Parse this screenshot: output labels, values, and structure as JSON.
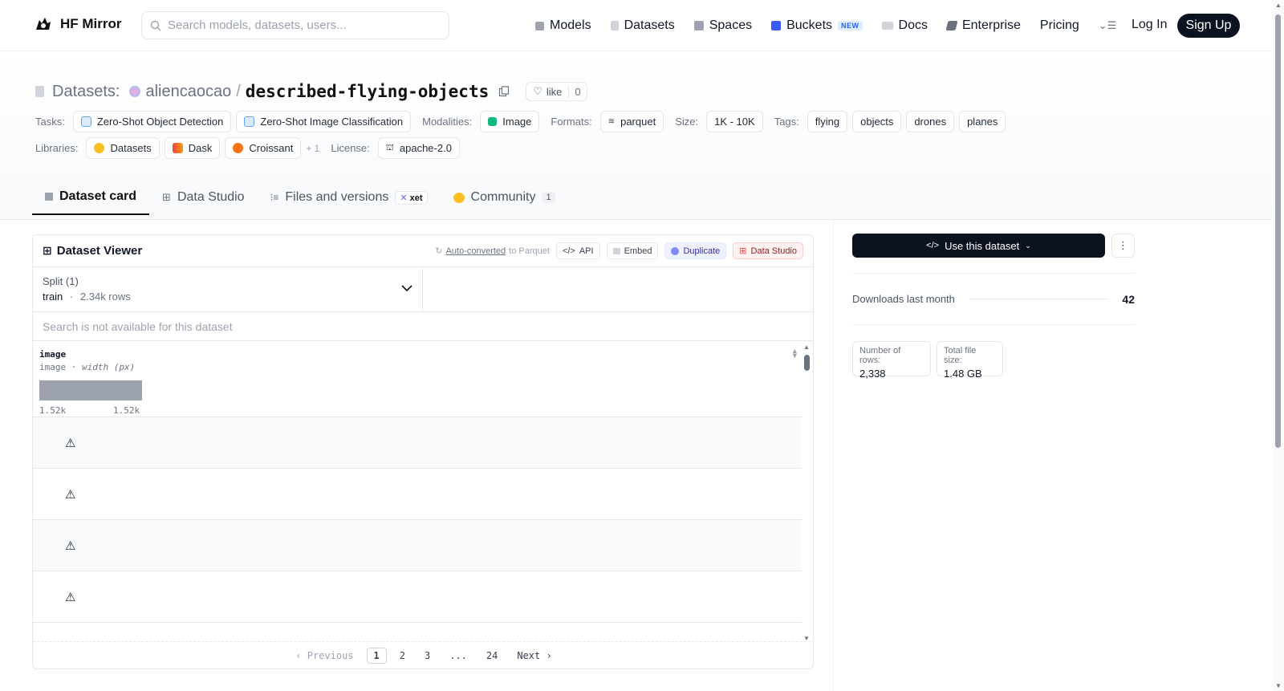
{
  "brand": {
    "name": "HF Mirror"
  },
  "search": {
    "placeholder": "Search models, datasets, users..."
  },
  "nav": {
    "items": [
      {
        "label": "Models",
        "icon": "cube-icon"
      },
      {
        "label": "Datasets",
        "icon": "database-icon"
      },
      {
        "label": "Spaces",
        "icon": "grid-icon"
      },
      {
        "label": "Buckets",
        "icon": "bucket-icon",
        "badge": "NEW"
      },
      {
        "label": "Docs",
        "icon": "book-icon"
      },
      {
        "label": "Enterprise",
        "icon": "enterprise-icon"
      },
      {
        "label": "Pricing"
      }
    ],
    "login": "Log In",
    "signup": "Sign Up"
  },
  "header": {
    "section": "Datasets:",
    "owner": "aliencaocao",
    "slash": "/",
    "name": "described-flying-objects",
    "like_label": "like",
    "like_count": "0"
  },
  "meta": {
    "tasks_label": "Tasks:",
    "tasks": [
      "Zero-Shot Object Detection",
      "Zero-Shot Image Classification"
    ],
    "modalities_label": "Modalities:",
    "modalities": [
      "Image"
    ],
    "formats_label": "Formats:",
    "formats": [
      "parquet"
    ],
    "size_label": "Size:",
    "size": "1K - 10K",
    "tags_label": "Tags:",
    "tags": [
      "flying",
      "objects",
      "drones",
      "planes"
    ],
    "libraries_label": "Libraries:",
    "libraries": [
      "Datasets",
      "Dask",
      "Croissant"
    ],
    "libraries_more": "+ 1",
    "license_label": "License:",
    "license": "apache-2.0"
  },
  "tabs": {
    "card": "Dataset card",
    "studio": "Data Studio",
    "files": "Files and versions",
    "xet": "xet",
    "community": "Community",
    "community_count": "1"
  },
  "viewer": {
    "title": "Dataset Viewer",
    "auto_converted": "Auto-converted",
    "to_parquet": "to Parquet",
    "api": "API",
    "embed": "Embed",
    "duplicate": "Duplicate",
    "data_studio": "Data Studio",
    "split_label": "Split (1)",
    "split_name": "train",
    "split_sep": "·",
    "split_rows": "2.34k rows",
    "search_disabled": "Search is not available for this dataset",
    "column": {
      "name": "image",
      "type": "image",
      "type_sep": "·",
      "stat": "width (px)",
      "hist_min": "1.52k",
      "hist_max": "1.52k"
    },
    "rows": [
      "⚠",
      "⚠",
      "⚠",
      "⚠"
    ],
    "pager": {
      "previous": "Previous",
      "pages": [
        "1",
        "2",
        "3",
        "...",
        "24"
      ],
      "next": "Next"
    }
  },
  "sidebar": {
    "use_dataset": "Use this dataset",
    "downloads_label": "Downloads last month",
    "downloads_value": "42",
    "rows_label": "Number of rows:",
    "rows_value": "2,338",
    "filesize_label": "Total file size:",
    "filesize_value": "1.48 GB"
  }
}
